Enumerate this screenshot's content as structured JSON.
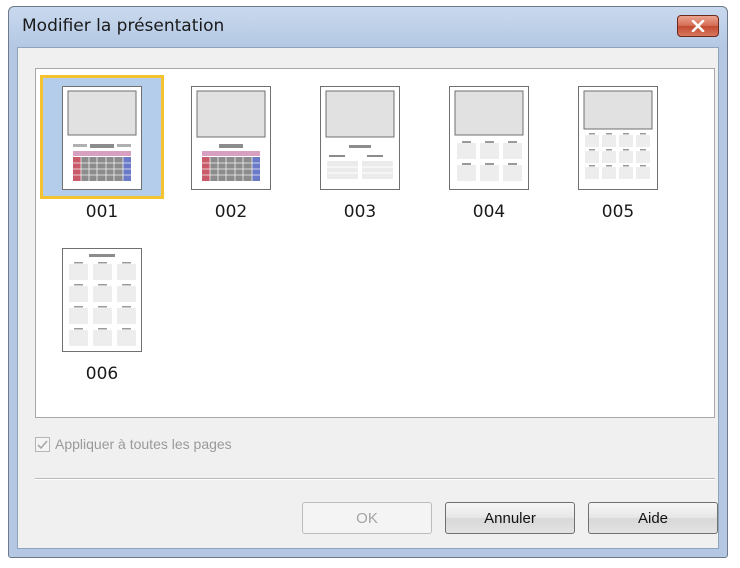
{
  "window": {
    "title": "Modifier la présentation"
  },
  "layouts": [
    {
      "label": "001",
      "selected": true
    },
    {
      "label": "002",
      "selected": false
    },
    {
      "label": "003",
      "selected": false
    },
    {
      "label": "004",
      "selected": false
    },
    {
      "label": "005",
      "selected": false
    },
    {
      "label": "006",
      "selected": false
    }
  ],
  "apply_all": {
    "label": "Appliquer à toutes les pages",
    "checked": true,
    "enabled": false
  },
  "buttons": {
    "ok": "OK",
    "cancel": "Annuler",
    "help": "Aide"
  },
  "icons": {
    "close": "close-icon",
    "checkbox": "checkmark-icon"
  },
  "colors": {
    "selection_fill": "#b4cdea",
    "selection_border": "#f5c230",
    "close_button": "#c9503a"
  }
}
